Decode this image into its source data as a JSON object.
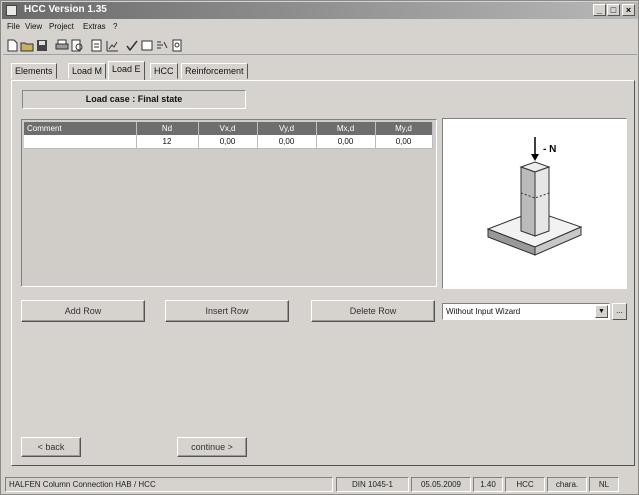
{
  "window": {
    "title": "HCC Version 1.35"
  },
  "menu": [
    {
      "label": "File"
    },
    {
      "label": "View"
    },
    {
      "label": "Project"
    },
    {
      "label": "Extras"
    },
    {
      "label": "?"
    }
  ],
  "toolbar_icons": [
    "new-file-icon",
    "open-folder-icon",
    "save-icon",
    "print-icon",
    "print-preview-icon",
    "export-icon",
    "chart-icon",
    "check-icon",
    "window-icon",
    "list-icon",
    "info-icon"
  ],
  "tabs": [
    {
      "label": "Elements"
    },
    {
      "label": "Load M"
    },
    {
      "label": "Load E"
    },
    {
      "label": "HCC"
    },
    {
      "label": "Reinforcement"
    }
  ],
  "active_tab": "Load E",
  "load_case": "Load case : Final state",
  "table": {
    "columns": [
      "Comment",
      "Nd",
      "Vx,d",
      "Vy,d",
      "Mx,d",
      "My,d"
    ],
    "rows": [
      [
        "",
        "12",
        "0,00",
        "0,00",
        "0,00",
        "0,00"
      ]
    ]
  },
  "figure": {
    "force_label": "- N"
  },
  "buttons": {
    "add_row": "Add Row",
    "insert_row": "Insert Row",
    "delete_row": "Delete Row",
    "back": "< back",
    "continue": "continue >"
  },
  "wizard_select": {
    "value": "Without Input Wizard",
    "more": "..."
  },
  "status": [
    "HALFEN Column Connection HAB / HCC",
    "DIN 1045-1",
    "05.05.2009",
    "1.40",
    "HCC",
    "chara.",
    "NL"
  ]
}
